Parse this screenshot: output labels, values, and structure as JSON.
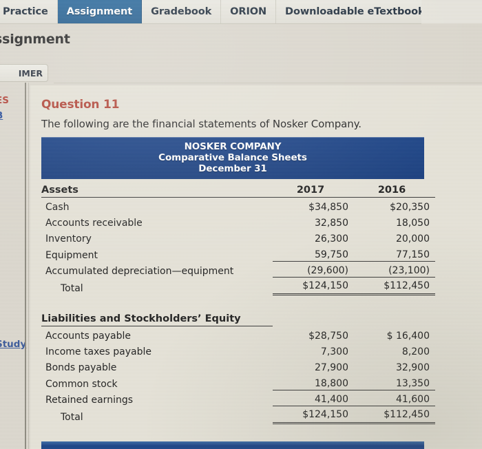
{
  "tabs": [
    {
      "label": "Practice",
      "active": false
    },
    {
      "label": "Assignment",
      "active": true
    },
    {
      "label": "Gradebook",
      "active": false
    },
    {
      "label": "ORION",
      "active": false
    },
    {
      "label": "Downloadable eTextbook",
      "active": false
    }
  ],
  "page": {
    "heading": "ssignment",
    "disclaimer_chip": "IMER"
  },
  "sidebar": {
    "resources_label": "ES",
    "b_label": "B",
    "study_label": "Study"
  },
  "question": {
    "title": "Question 11",
    "intro": "The following are the financial statements of Nosker Company."
  },
  "statement": {
    "company": "NOSKER COMPANY",
    "title": "Comparative Balance Sheets",
    "date": "December 31",
    "year_cols": [
      "2017",
      "2016"
    ],
    "sections": [
      {
        "heading": "Assets",
        "rows": [
          {
            "label": "Cash",
            "indent": false,
            "values": [
              "$34,850",
              "$20,350"
            ],
            "style": ""
          },
          {
            "label": "Accounts receivable",
            "indent": false,
            "values": [
              "32,850",
              "18,050"
            ],
            "style": ""
          },
          {
            "label": "Inventory",
            "indent": false,
            "values": [
              "26,300",
              "20,000"
            ],
            "style": ""
          },
          {
            "label": "Equipment",
            "indent": false,
            "values": [
              "59,750",
              "77,150"
            ],
            "style": ""
          },
          {
            "label": "Accumulated depreciation—equipment",
            "indent": false,
            "values": [
              "(29,600)",
              "(23,100)"
            ],
            "style": "total"
          },
          {
            "label": "Total",
            "indent": true,
            "values": [
              "$124,150",
              "$112,450"
            ],
            "style": "grand"
          }
        ]
      },
      {
        "heading": "Liabilities and Stockholders’ Equity",
        "rows": [
          {
            "label": "Accounts payable",
            "indent": false,
            "values": [
              "$28,750",
              "$ 16,400"
            ],
            "style": ""
          },
          {
            "label": "Income taxes payable",
            "indent": false,
            "values": [
              "7,300",
              "8,200"
            ],
            "style": ""
          },
          {
            "label": "Bonds payable",
            "indent": false,
            "values": [
              "27,900",
              "32,900"
            ],
            "style": ""
          },
          {
            "label": "Common stock",
            "indent": false,
            "values": [
              "18,800",
              "13,350"
            ],
            "style": ""
          },
          {
            "label": "Retained earnings",
            "indent": false,
            "values": [
              "41,400",
              "41,600"
            ],
            "style": "total"
          },
          {
            "label": "Total",
            "indent": true,
            "values": [
              "$124,150",
              "$112,450"
            ],
            "style": "grand"
          }
        ]
      }
    ]
  },
  "colors": {
    "header_blue": "#1c4488",
    "active_tab_blue": "#2d6b9e",
    "question_red": "#b4483b",
    "link_blue": "#2a4f9c",
    "page_bg": "#e7e4d9"
  }
}
